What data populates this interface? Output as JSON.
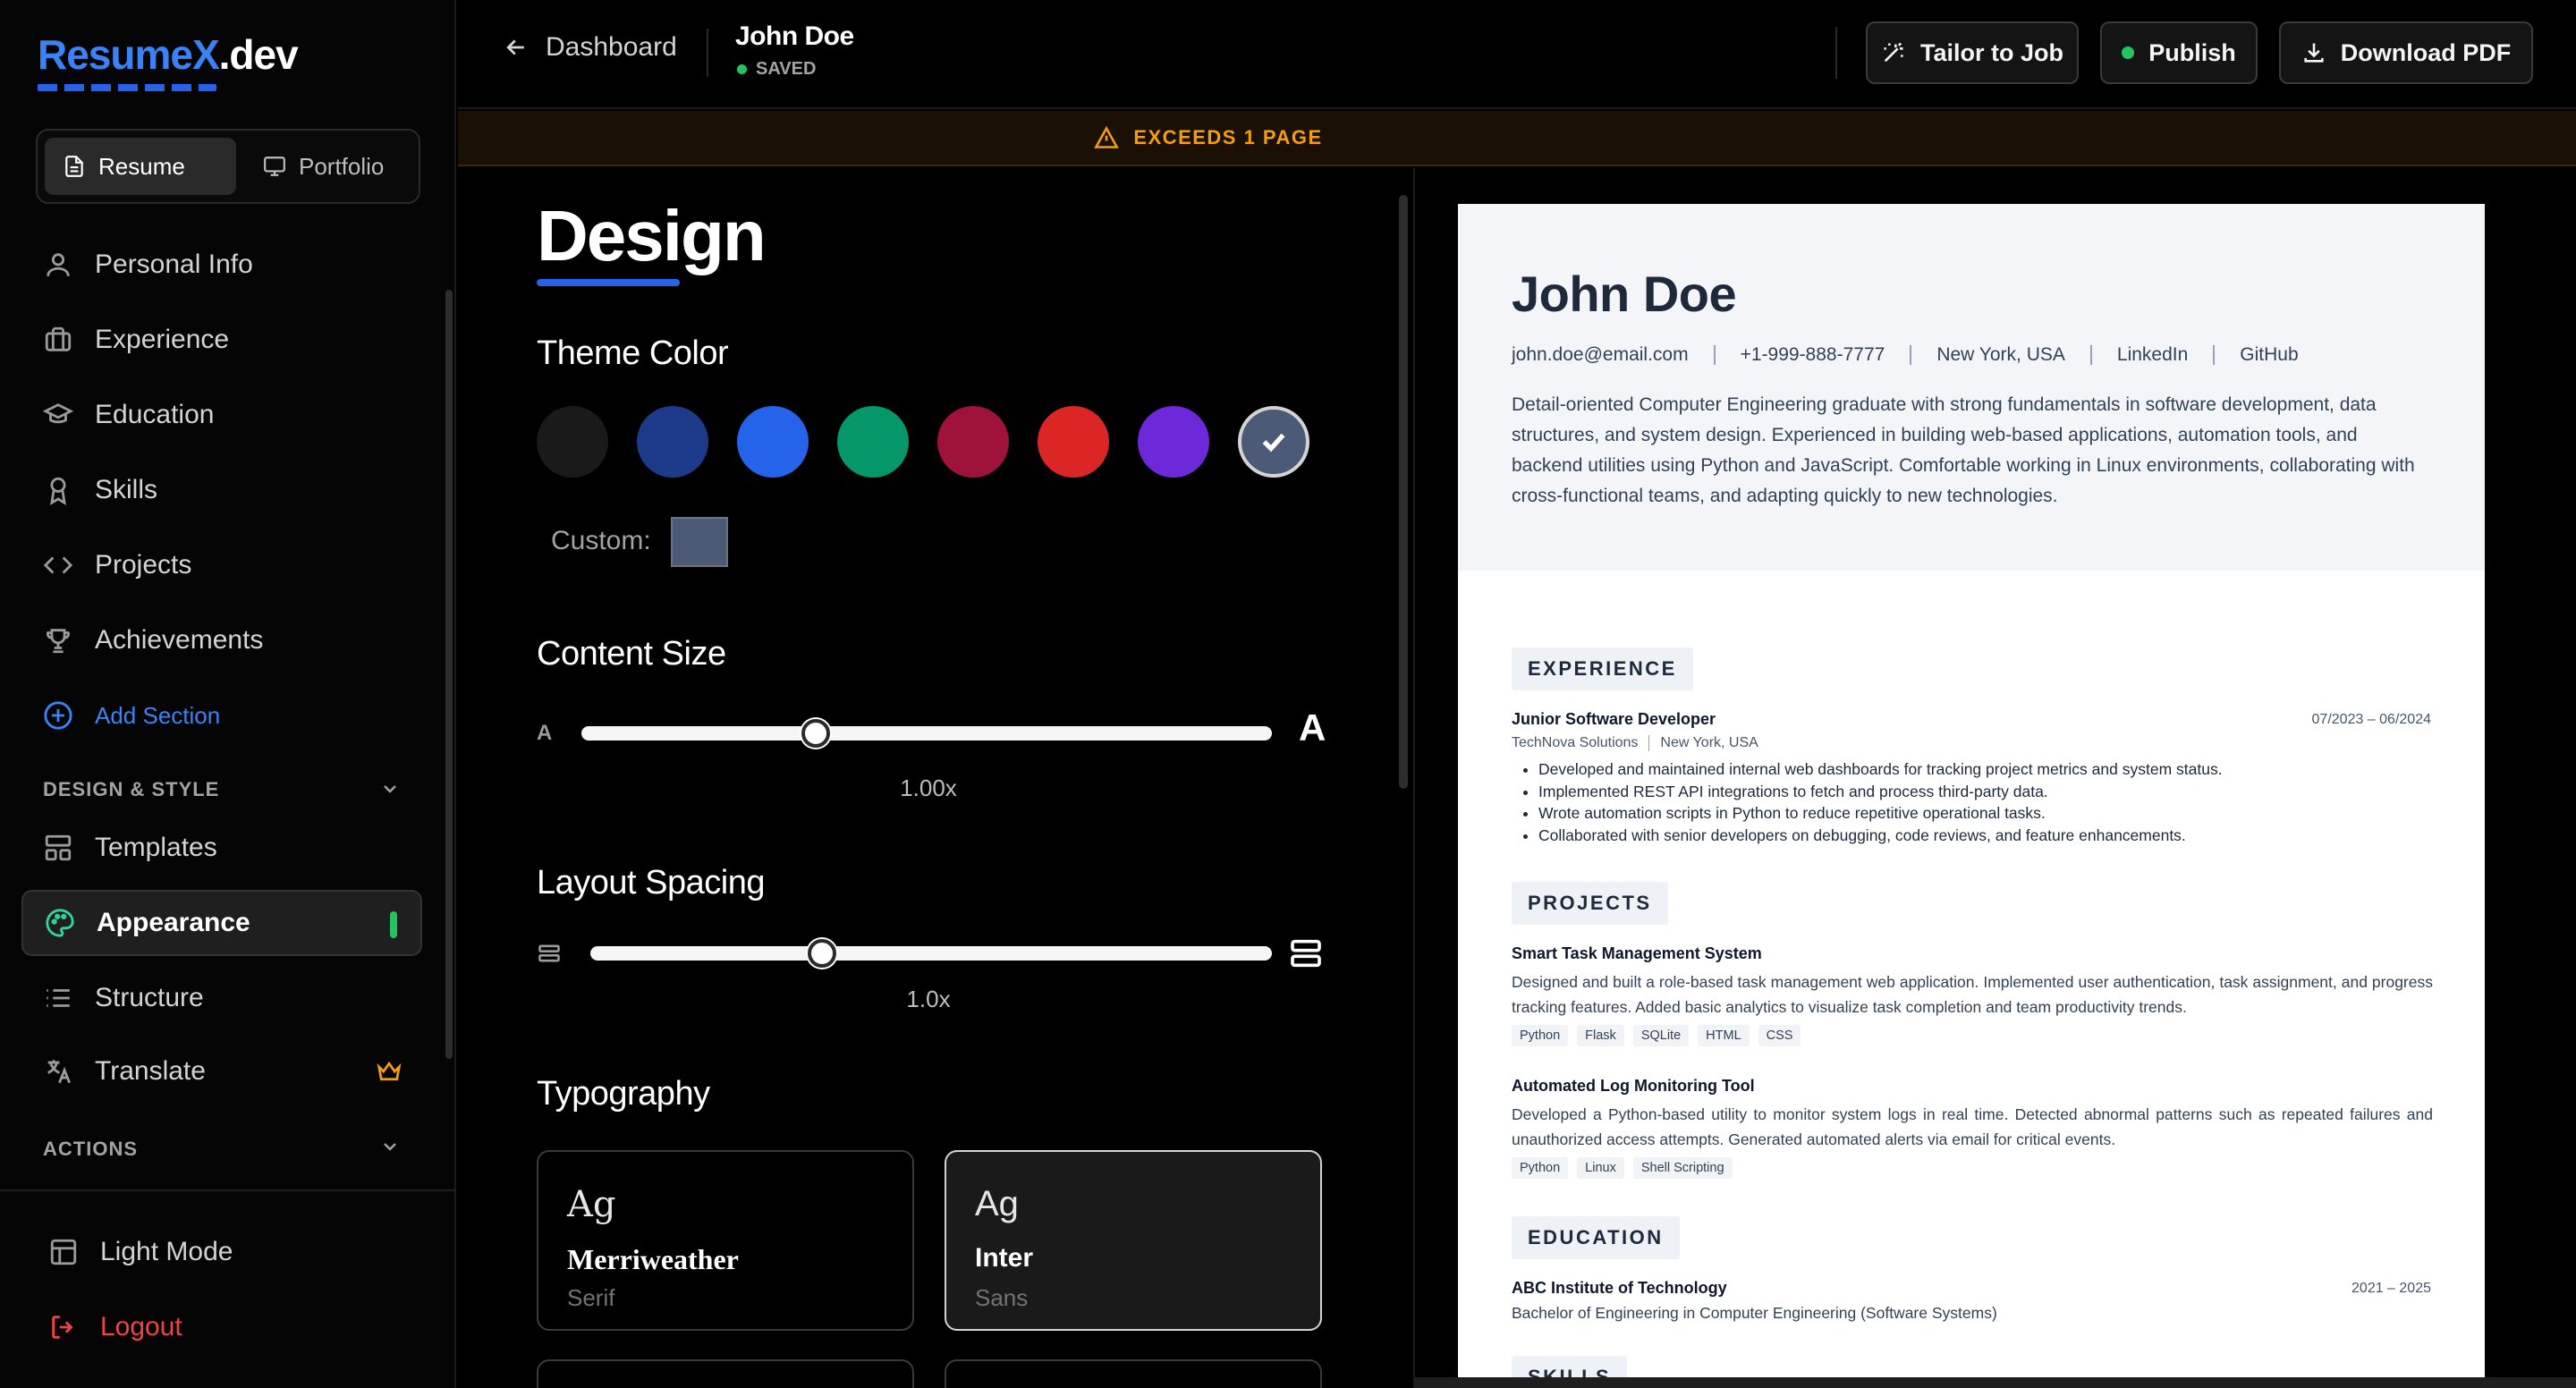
{
  "brand": {
    "part1": "ResumeX",
    "part2": ".dev"
  },
  "mode_toggle": {
    "resume": "Resume",
    "portfolio": "Portfolio"
  },
  "sidebar": {
    "items": [
      {
        "label": "Personal Info",
        "icon": "user-icon"
      },
      {
        "label": "Experience",
        "icon": "briefcase-icon"
      },
      {
        "label": "Education",
        "icon": "graduation-cap-icon"
      },
      {
        "label": "Skills",
        "icon": "award-icon"
      },
      {
        "label": "Projects",
        "icon": "code-icon"
      },
      {
        "label": "Achievements",
        "icon": "trophy-icon"
      }
    ],
    "add_section": "Add Section",
    "design_label": "DESIGN & STYLE",
    "design_items": [
      {
        "label": "Templates",
        "icon": "layout-icon"
      },
      {
        "label": "Appearance",
        "icon": "palette-icon",
        "active": true
      },
      {
        "label": "Structure",
        "icon": "list-icon"
      },
      {
        "label": "Translate",
        "icon": "translate-icon",
        "premium": true
      }
    ],
    "actions_label": "ACTIONS",
    "light_mode": "Light Mode",
    "logout": "Logout"
  },
  "header": {
    "back": "Dashboard",
    "doc_title": "John Doe",
    "status": "SAVED",
    "tailor": "Tailor to Job",
    "publish": "Publish",
    "download": "Download PDF"
  },
  "warning": "EXCEEDS 1 PAGE",
  "design": {
    "title": "Design",
    "theme_color_title": "Theme Color",
    "colors": [
      "#1a1a1a",
      "#1e3a8a",
      "#2563eb",
      "#059669",
      "#9f1239",
      "#dc2626",
      "#6d28d9",
      "#4b5a76"
    ],
    "selected_color": "#4b5a76",
    "custom_label": "Custom:",
    "content_size_title": "Content Size",
    "content_size_small": "A",
    "content_size_big": "A",
    "content_size_fraction": 0.34,
    "content_size_value": "1.00x",
    "layout_spacing_title": "Layout Spacing",
    "layout_spacing_fraction": 0.34,
    "layout_spacing_value": "1.0x",
    "typography_title": "Typography",
    "fonts": [
      {
        "sample": "Ag",
        "name": "Merriweather",
        "kind": "Serif"
      },
      {
        "sample": "Ag",
        "name": "Inter",
        "kind": "Sans",
        "selected": true
      }
    ]
  },
  "resume": {
    "name": "John Doe",
    "contacts": [
      "john.doe@email.com",
      "+1-999-888-7777",
      "New York, USA",
      "LinkedIn",
      "GitHub"
    ],
    "summary": "Detail-oriented Computer Engineering graduate with strong fundamentals in software development, data structures, and system design. Experienced in building web-based applications, automation tools, and backend utilities using Python and JavaScript. Comfortable working in Linux environments, collaborating with cross-functional teams, and adapting quickly to new technologies.",
    "experience_title": "EXPERIENCE",
    "experience": {
      "role": "Junior Software Developer",
      "dates": "07/2023 – 06/2024",
      "company": "TechNova Solutions",
      "location": "New York, USA",
      "bullets": [
        "Developed and maintained internal web dashboards for tracking project metrics and system status.",
        "Implemented REST API integrations to fetch and process third-party data.",
        "Wrote automation scripts in Python to reduce repetitive operational tasks.",
        "Collaborated with senior developers on debugging, code reviews, and feature enhancements."
      ]
    },
    "projects_title": "PROJECTS",
    "projects": [
      {
        "name": "Smart Task Management System",
        "desc": "Designed and built a role-based task management web application. Implemented user authentication, task assignment, and progress tracking features. Added basic analytics to visualize task completion and team productivity trends.",
        "tags": [
          "Python",
          "Flask",
          "SQLite",
          "HTML",
          "CSS"
        ]
      },
      {
        "name": "Automated Log Monitoring Tool",
        "desc": "Developed a Python-based utility to monitor system logs in real time. Detected abnormal patterns such as repeated failures and unauthorized access attempts. Generated automated alerts via email for critical events.",
        "tags": [
          "Python",
          "Linux",
          "Shell Scripting"
        ]
      }
    ],
    "education_title": "EDUCATION",
    "education": {
      "school": "ABC Institute of Technology",
      "dates": "2021 – 2025",
      "degree": "Bachelor of Engineering in Computer Engineering (Software Systems)"
    },
    "skills_title": "SKILLS"
  }
}
